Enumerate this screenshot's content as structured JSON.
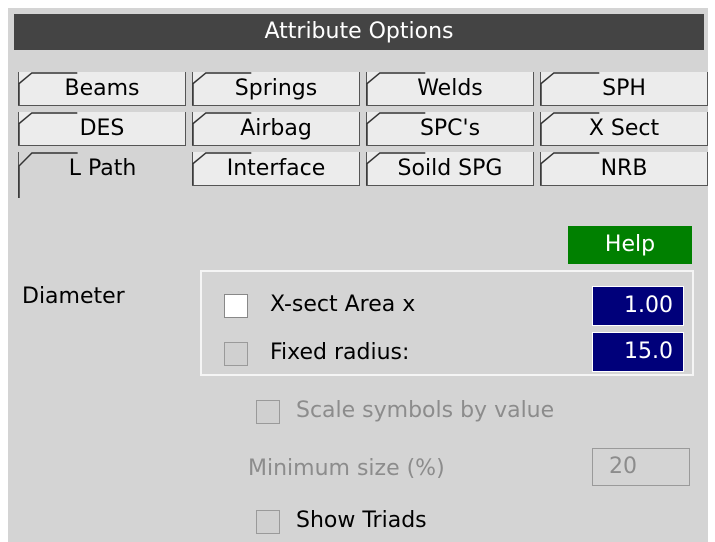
{
  "window": {
    "title": "Attribute Options"
  },
  "tabs": [
    {
      "label": "Beams"
    },
    {
      "label": "Springs"
    },
    {
      "label": "Welds"
    },
    {
      "label": "SPH"
    },
    {
      "label": "DES"
    },
    {
      "label": "Airbag"
    },
    {
      "label": "SPC's"
    },
    {
      "label": "X Sect"
    },
    {
      "label": "L Path",
      "active": true
    },
    {
      "label": "Interface"
    },
    {
      "label": "Soild SPG"
    },
    {
      "label": "NRB"
    }
  ],
  "help": {
    "label": "Help",
    "color": "#008000"
  },
  "diameter": {
    "label": "Diameter",
    "xsect": {
      "label": "X-sect Area x",
      "value": "1.00",
      "checked": false
    },
    "fixed": {
      "label": "Fixed radius:",
      "value": "15.0",
      "checked": false
    }
  },
  "scale_symbols": {
    "label": "Scale symbols by value",
    "enabled": false
  },
  "min_size": {
    "label": "Minimum size (%)",
    "value": "20",
    "enabled": false
  },
  "show_triads": {
    "label": "Show Triads",
    "checked": false
  }
}
